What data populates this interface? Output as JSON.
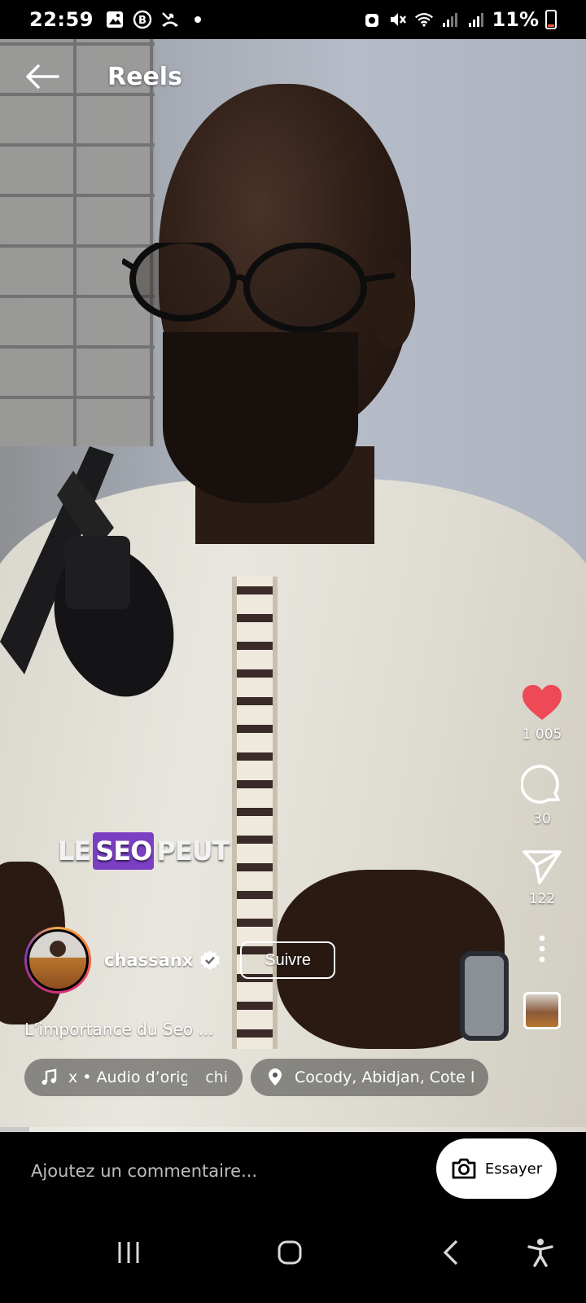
{
  "status_bar": {
    "time": "22:59",
    "battery": "11%",
    "icons": [
      "image-icon",
      "b-icon",
      "missed-call-icon",
      "dot-icon",
      "alarm-icon",
      "mute-icon",
      "wifi-icon",
      "signal-icon",
      "signal-icon-2",
      "battery-icon"
    ]
  },
  "header": {
    "title": "Reels",
    "back_icon": "arrow-left-icon"
  },
  "video": {
    "overlay_words": [
      "LE",
      "SEO",
      "PEUT"
    ],
    "highlight_color": "#7b3fc4",
    "progress": 0.05
  },
  "actions": {
    "likes": "1 005",
    "comments": "30",
    "shares": "122",
    "like_color": "#ed4956"
  },
  "author": {
    "username": "chassanx",
    "follow_label": "Suivre"
  },
  "caption": "L’importance du Seo ...",
  "audio": {
    "label": "x • Audio d’origine",
    "tail": "chi"
  },
  "location": "Cocody, Abidjan, Cote D'I...",
  "comment_bar": {
    "placeholder": "Ajoutez un commentaire...",
    "try_label": "Essayer"
  },
  "nav": {
    "icons": [
      "recents-icon",
      "home-icon",
      "back-icon",
      "accessibility-icon"
    ]
  }
}
